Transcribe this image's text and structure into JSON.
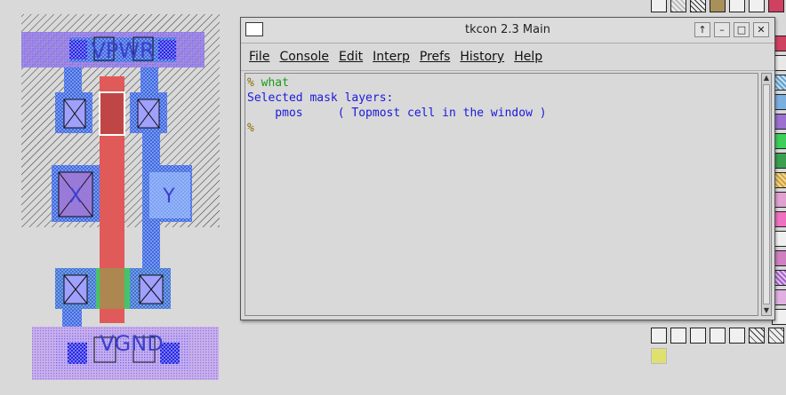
{
  "layout": {
    "labels": {
      "vpwr": "VPWR",
      "vgnd": "VGND",
      "x": "X",
      "y": "Y"
    }
  },
  "window": {
    "title": "tkcon 2.3 Main",
    "buttons": [
      "↑",
      "–",
      "□",
      "✕"
    ],
    "menu": [
      {
        "label": "File"
      },
      {
        "label": "Console"
      },
      {
        "label": "Edit"
      },
      {
        "label": "Interp"
      },
      {
        "label": "Prefs"
      },
      {
        "label": "History"
      },
      {
        "label": "Help"
      }
    ]
  },
  "console": {
    "prompt": "%",
    "command": " what",
    "output_1": "Selected mask layers:",
    "output_2": "    pmos     ( Topmost cell in the window )",
    "prompt_2": "%"
  },
  "colors": {
    "console_prompt": "#8b6a00",
    "console_command": "#1a9a1a",
    "console_output": "#1a1adc",
    "metal1": "#8080ff",
    "poly": "#e05050",
    "nwell_hatch": "#333333",
    "pwell": "#b890e0",
    "diff": "#30c060"
  }
}
